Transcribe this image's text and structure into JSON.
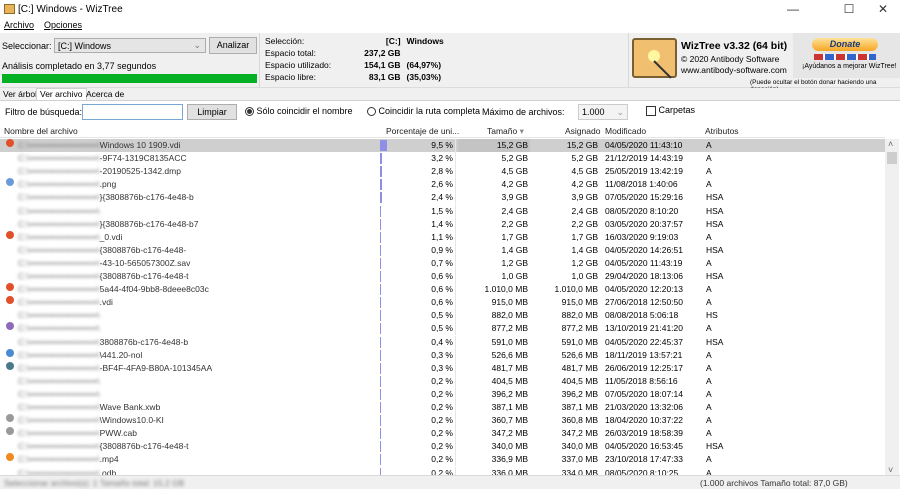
{
  "window": {
    "title": "[C:] Windows  - WizTree",
    "minimize": "—",
    "maximize": "☐",
    "close": "✕"
  },
  "menu": [
    "Archivo",
    "Opciones"
  ],
  "scan": {
    "select_label": "Seleccionar:",
    "drive": "[C:] Windows",
    "analyze": "Analizar",
    "status": "Análisis completado en 3,77 segundos",
    "progress": 1.0
  },
  "info": {
    "selection_label": "Selección:",
    "selection_drive": "[C:]",
    "selection_name": "Windows",
    "total_label": "Espacio total:",
    "total": "237,2 GB",
    "used_label": "Espacio utilizado:",
    "used": "154,1 GB",
    "used_pct": "(64,97%)",
    "free_label": "Espacio libre:",
    "free": "83,1 GB",
    "free_pct": "(35,03%)"
  },
  "about": {
    "product": "WizTree v3.32 (64 bit)",
    "copyright": "© 2020 Antibody Software",
    "url": "www.antibody-software.com",
    "donate": "Donate",
    "help": "¡Ayúdanos a mejorar WizTree!",
    "hide_note": "(Puede ocultar el botón donar haciendo una donación)"
  },
  "tabs": [
    "Ver árbol",
    "Ver archivo",
    "Acerca de"
  ],
  "filter": {
    "label": "Filtro de búsqueda:",
    "value": "",
    "clear": "Limpiar",
    "opt_name": "Sólo coincidir el nombre",
    "opt_path": "Coincidir la ruta completa",
    "max_label": "Máximo de archivos:",
    "max_value": "1.000",
    "folders": "Carpetas"
  },
  "columns": {
    "name": "Nombre del archivo",
    "pct": "Porcentaje de uni...",
    "size": "Tamaño",
    "alloc": "Asignado",
    "modified": "Modificado",
    "attrs": "Atributos"
  },
  "colors": {
    "progress": "#06b025",
    "pct_bar": "#8f8fe8",
    "selected_row": "#cfcfcf"
  },
  "rows": [
    {
      "name": "Windows 10 1909.vdi",
      "pct": "9,5 %",
      "p": 9.5,
      "size": "15,2 GB",
      "alloc": "15,2 GB",
      "mod": "04/05/2020 11:43:10",
      "attr": "A",
      "icon": "#e0502a"
    },
    {
      "name": "-9F74-1319C8135ACC",
      "pct": "3,2 %",
      "p": 3.2,
      "size": "5,2 GB",
      "alloc": "5,2 GB",
      "mod": "21/12/2019 14:43:19",
      "attr": "A",
      "icon": ""
    },
    {
      "name": "-20190525-1342.dmp",
      "pct": "2,8 %",
      "p": 2.8,
      "size": "4,5 GB",
      "alloc": "4,5 GB",
      "mod": "25/05/2019 13:42:19",
      "attr": "A",
      "icon": ""
    },
    {
      "name": ".png",
      "pct": "2,6 %",
      "p": 2.6,
      "size": "4,2 GB",
      "alloc": "4,2 GB",
      "mod": "11/08/2018 1:40:06",
      "attr": "A",
      "icon": "#6a9bd8"
    },
    {
      "name": "}{3808876b-c176-4e48-b",
      "pct": "2,4 %",
      "p": 2.4,
      "size": "3,9 GB",
      "alloc": "3,9 GB",
      "mod": "07/05/2020 15:29:16",
      "attr": "HSA",
      "icon": ""
    },
    {
      "name": "",
      "pct": "1,5 %",
      "p": 1.5,
      "size": "2,4 GB",
      "alloc": "2,4 GB",
      "mod": "08/05/2020 8:10:20",
      "attr": "HSA",
      "icon": ""
    },
    {
      "name": "}{3808876b-c176-4e48-b7",
      "pct": "1,4 %",
      "p": 1.4,
      "size": "2,2 GB",
      "alloc": "2,2 GB",
      "mod": "03/05/2020 20:37:57",
      "attr": "HSA",
      "icon": ""
    },
    {
      "name": "_0.vdi",
      "pct": "1,1 %",
      "p": 1.1,
      "size": "1,7 GB",
      "alloc": "1,7 GB",
      "mod": "16/03/2020 9:19:03",
      "attr": "A",
      "icon": "#e0502a"
    },
    {
      "name": "{3808876b-c176-4e48-",
      "pct": "0,9 %",
      "p": 0.9,
      "size": "1,4 GB",
      "alloc": "1,4 GB",
      "mod": "04/05/2020 14:26:51",
      "attr": "HSA",
      "icon": ""
    },
    {
      "name": "-43-10-565057300Z.sav",
      "pct": "0,7 %",
      "p": 0.7,
      "size": "1,2 GB",
      "alloc": "1,2 GB",
      "mod": "04/05/2020 11:43:19",
      "attr": "A",
      "icon": ""
    },
    {
      "name": "{3808876b-c176-4e48-t",
      "pct": "0,6 %",
      "p": 0.6,
      "size": "1,0 GB",
      "alloc": "1,0 GB",
      "mod": "29/04/2020 18:13:06",
      "attr": "HSA",
      "icon": ""
    },
    {
      "name": "5a44-4f04-9bb8-8deee8c03c",
      "pct": "0,6 %",
      "p": 0.6,
      "size": "1.010,0 MB",
      "alloc": "1.010,0 MB",
      "mod": "04/05/2020 12:20:13",
      "attr": "A",
      "icon": "#e0502a"
    },
    {
      "name": ".vdi",
      "pct": "0,6 %",
      "p": 0.6,
      "size": "915,0 MB",
      "alloc": "915,0 MB",
      "mod": "27/06/2018 12:50:50",
      "attr": "A",
      "icon": "#e0502a"
    },
    {
      "name": "",
      "pct": "0,5 %",
      "p": 0.5,
      "size": "882,0 MB",
      "alloc": "882,0 MB",
      "mod": "08/08/2018 5:06:18",
      "attr": "HS",
      "icon": ""
    },
    {
      "name": "",
      "pct": "0,5 %",
      "p": 0.5,
      "size": "877,2 MB",
      "alloc": "877,2 MB",
      "mod": "13/10/2019 21:41:20",
      "attr": "A",
      "icon": "#8e6bb8"
    },
    {
      "name": "3808876b-c176-4e48-b",
      "pct": "0,4 %",
      "p": 0.4,
      "size": "591,0 MB",
      "alloc": "591,0 MB",
      "mod": "04/05/2020 22:45:37",
      "attr": "HSA",
      "icon": ""
    },
    {
      "name": "\\441.20-nol",
      "pct": "0,3 %",
      "p": 0.3,
      "size": "526,6 MB",
      "alloc": "526,6 MB",
      "mod": "18/11/2019 13:57:21",
      "attr": "A",
      "icon": "#4a8ad0"
    },
    {
      "name": "-BF4F-4FA9-B80A-101345AA",
      "pct": "0,3 %",
      "p": 0.3,
      "size": "481,7 MB",
      "alloc": "481,7 MB",
      "mod": "26/06/2019 12:25:17",
      "attr": "A",
      "icon": "#4a7a8a"
    },
    {
      "name": "",
      "pct": "0,2 %",
      "p": 0.2,
      "size": "404,5 MB",
      "alloc": "404,5 MB",
      "mod": "11/05/2018 8:56:16",
      "attr": "A",
      "icon": ""
    },
    {
      "name": "",
      "pct": "0,2 %",
      "p": 0.2,
      "size": "396,2 MB",
      "alloc": "396,2 MB",
      "mod": "07/05/2020 18:07:14",
      "attr": "A",
      "icon": ""
    },
    {
      "name": "Wave Bank.xwb",
      "pct": "0,2 %",
      "p": 0.2,
      "size": "387,1 MB",
      "alloc": "387,1 MB",
      "mod": "21/03/2020 13:32:06",
      "attr": "A",
      "icon": ""
    },
    {
      "name": "\\Windows10.0-KI",
      "pct": "0,2 %",
      "p": 0.2,
      "size": "360,7 MB",
      "alloc": "360,8 MB",
      "mod": "18/04/2020 10:37:22",
      "attr": "A",
      "icon": "#999999"
    },
    {
      "name": "PWW.cab",
      "pct": "0,2 %",
      "p": 0.2,
      "size": "347,2 MB",
      "alloc": "347,2 MB",
      "mod": "26/03/2019 18:58:39",
      "attr": "A",
      "icon": "#999999"
    },
    {
      "name": "{3808876b-c176-4e48-t",
      "pct": "0,2 %",
      "p": 0.2,
      "size": "340,0 MB",
      "alloc": "340,0 MB",
      "mod": "04/05/2020 16:53:45",
      "attr": "HSA",
      "icon": ""
    },
    {
      "name": ".mp4",
      "pct": "0,2 %",
      "p": 0.2,
      "size": "336,9 MB",
      "alloc": "337,0 MB",
      "mod": "23/10/2018 17:47:33",
      "attr": "A",
      "icon": "#f08a20"
    },
    {
      "name": ".odb",
      "pct": "0,2 %",
      "p": 0.2,
      "size": "336,0 MB",
      "alloc": "334,0 MB",
      "mod": "08/05/2020 8:10:25",
      "attr": "A",
      "icon": ""
    }
  ],
  "status": {
    "left": "Seleccionar archivo(s): 1   Tamaño total: 15,2 GB",
    "right": "(1.000 archivos  Tamaño total: 87,0 GB)"
  }
}
